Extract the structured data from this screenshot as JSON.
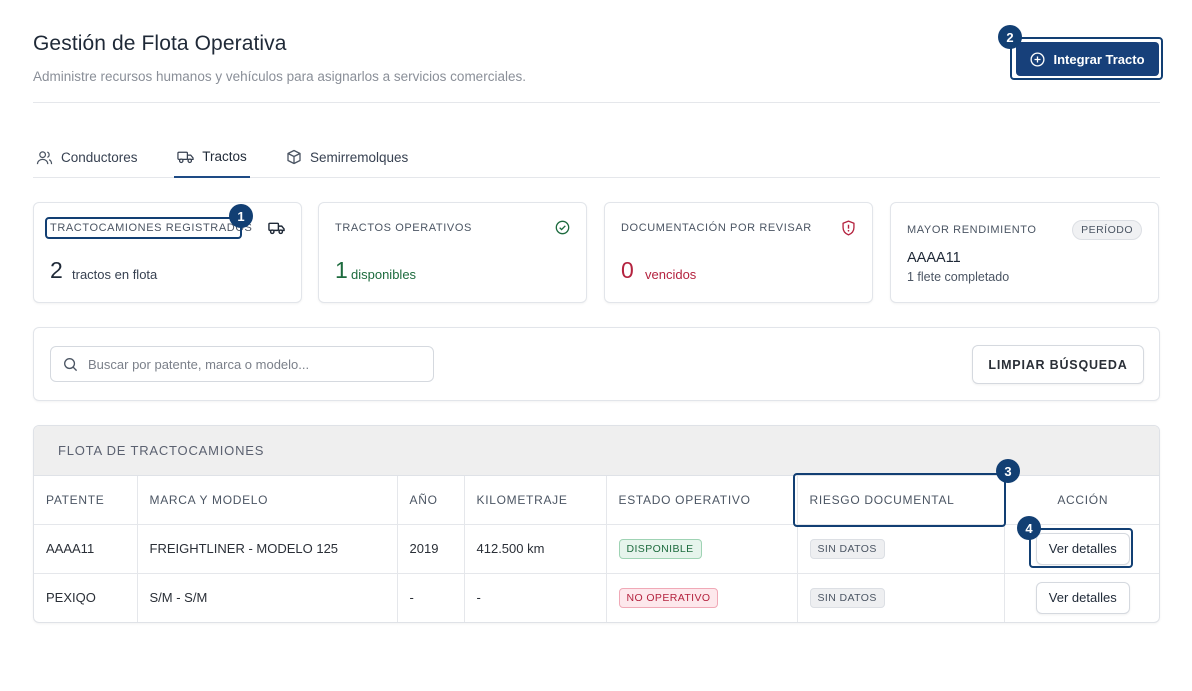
{
  "header": {
    "title": "Gestión de Flota Operativa",
    "subtitle": "Administre recursos humanos y vehículos para asignarlos a servicios comerciales.",
    "primary_button": "Integrar Tracto"
  },
  "annotations": [
    "1",
    "2",
    "3",
    "4"
  ],
  "tabs": [
    {
      "label": "Conductores",
      "icon": "users-icon",
      "active": false
    },
    {
      "label": "Tractos",
      "icon": "truck-icon",
      "active": true
    },
    {
      "label": "Semirremolques",
      "icon": "box-icon",
      "active": false
    }
  ],
  "cards": {
    "registered": {
      "label": "TRACTOCAMIONES REGISTRADOS",
      "value": "2",
      "caption": "tractos en flota",
      "icon": "truck-icon"
    },
    "operative": {
      "label": "TRACTOS OPERATIVOS",
      "value": "1",
      "caption": "disponibles",
      "icon": "check-circle-icon"
    },
    "documentation": {
      "label": "DOCUMENTACIÓN POR REVISAR",
      "value": "0",
      "caption": "vencidos",
      "icon": "shield-alert-icon"
    },
    "performance": {
      "label": "MAYOR RENDIMIENTO",
      "badge": "PERÍODO",
      "value": "AAAA11",
      "caption": "1 flete completado"
    }
  },
  "search": {
    "placeholder": "Buscar por patente, marca o modelo...",
    "clear_button": "LIMPIAR BÚSQUEDA"
  },
  "table": {
    "title": "FLOTA DE TRACTOCAMIONES",
    "columns": [
      "PATENTE",
      "MARCA Y MODELO",
      "AÑO",
      "KILOMETRAJE",
      "ESTADO OPERATIVO",
      "RIESGO DOCUMENTAL",
      "ACCIÓN"
    ],
    "rows": [
      {
        "patente": "AAAA11",
        "marca_modelo": "FREIGHTLINER - MODELO 125",
        "anio": "2019",
        "km": "412.500 km",
        "estado": "DISPONIBLE",
        "riesgo": "SIN DATOS",
        "accion": "Ver detalles"
      },
      {
        "patente": "PEXIQO",
        "marca_modelo": "S/M - S/M",
        "anio": "-",
        "km": "-",
        "estado": "NO OPERATIVO",
        "riesgo": "SIN DATOS",
        "accion": "Ver detalles"
      }
    ]
  },
  "colors": {
    "primary": "#17407a",
    "success": "#1d6b3e",
    "danger": "#b4233f",
    "annotation": "#123f73"
  }
}
